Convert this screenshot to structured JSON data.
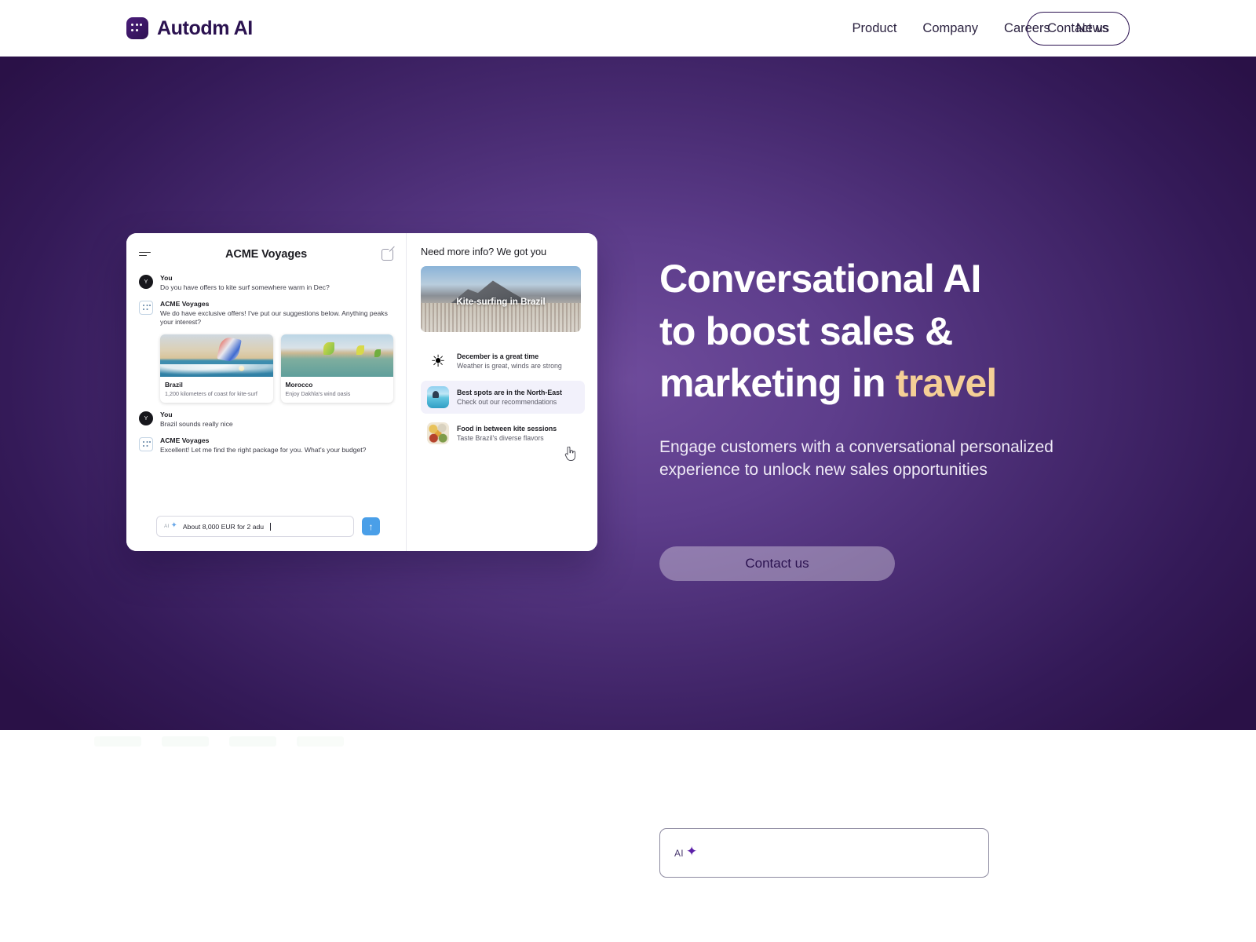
{
  "brand": {
    "name": "Autodm AI",
    "logo_icon": "chat-grid-logo-icon",
    "logo_color": "#3d1a6b"
  },
  "nav": {
    "links": [
      {
        "label": "Product"
      },
      {
        "label": "Company"
      },
      {
        "label": "Careers"
      },
      {
        "label": "News"
      }
    ],
    "cta_label": "Contact us"
  },
  "hero": {
    "headline_line1": "Conversational AI",
    "headline_line2": "to boost sales &",
    "headline_line3_plain": "marketing in ",
    "headline_line3_accent": "travel",
    "accent_color": "#f5cf96",
    "subhead_line1": "Engage customers with a conversational personalized",
    "subhead_line2": "experience to unlock new sales opportunities",
    "cta_label": "Contact us",
    "background_start": "#6e4b9b",
    "background_end": "#2a1147"
  },
  "mockup": {
    "left": {
      "menu_icon": "hamburger-menu-icon",
      "title": "ACME Voyages",
      "compose_icon": "compose-pencil-icon",
      "messages": [
        {
          "avatar": "Y",
          "avatar_icon": "user-avatar",
          "name": "You",
          "text": "Do you have offers to kite surf somewhere warm in Dec?"
        },
        {
          "avatar_icon": "bot-avatar",
          "name": "ACME Voyages",
          "text": "We do have exclusive offers! I've put our suggestions below. Anything peaks your interest?"
        },
        {
          "avatar": "Y",
          "avatar_icon": "user-avatar",
          "name": "You",
          "text": "Brazil sounds really nice"
        },
        {
          "avatar_icon": "bot-avatar",
          "name": "ACME Voyages",
          "text": "Excellent! Let me find the right package for you. What's your budget?"
        }
      ],
      "cards": [
        {
          "title": "Brazil",
          "subtitle": "1,200 kilometers of coast for kite-surf",
          "image": "kitesurf-dune-photo"
        },
        {
          "title": "Morocco",
          "subtitle": "Enjoy Dakhla's wind oasis",
          "image": "kitesurf-lagoon-photo"
        }
      ],
      "composer": {
        "ai_label": "AI",
        "ai_icon": "sparkle-icon",
        "value": "About 8,000 EUR for 2 adu",
        "send_icon": "arrow-up-icon",
        "send_color": "#4a9fe8"
      }
    },
    "right": {
      "title": "Need more info? We got you",
      "hero_image_label": "Kite-surfing in Brazil",
      "hero_image": "rio-beach-photo",
      "items": [
        {
          "icon": "sun-icon",
          "title": "December is a great time",
          "subtitle": "Weather is great, winds are strong",
          "active": false
        },
        {
          "icon": "beach-thumbnail-icon",
          "title": "Best spots are in the North-East",
          "subtitle": "Check out our recommendations",
          "active": true
        },
        {
          "icon": "food-thumbnail-icon",
          "title": "Food in between kite sessions",
          "subtitle": "Taste Brazil's diverse flavors",
          "active": false
        }
      ],
      "cursor_icon": "pointing-hand-cursor"
    }
  },
  "lower": {
    "ai_input": {
      "badge_label": "AI",
      "badge_icon": "sparkle-icon",
      "value": "",
      "placeholder": ""
    }
  }
}
